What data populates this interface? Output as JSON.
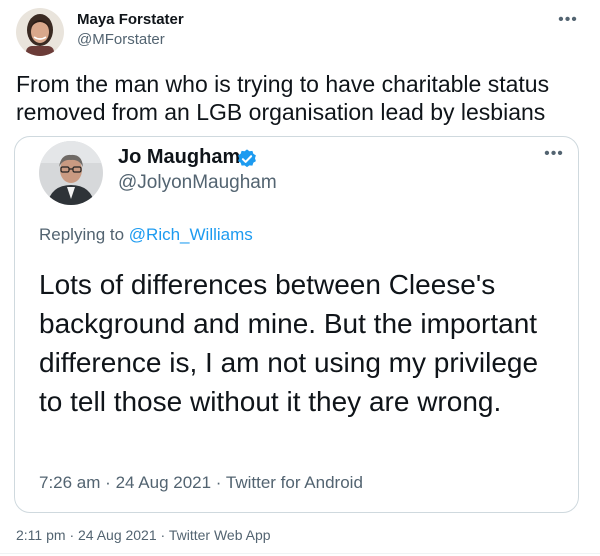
{
  "outer": {
    "name": "Maya Forstater",
    "handle": "@MForstater",
    "text": "From the man who is trying to have charitable status removed from an LGB organisation lead by lesbians",
    "time": "2:11 pm",
    "date": "24 Aug 2021",
    "source": "Twitter Web App",
    "separator": "·"
  },
  "quoted": {
    "name": "Jo Maugham",
    "handle": "@JolyonMaugham",
    "verified": true,
    "replying_prefix": "Replying to ",
    "replying_to": "@Rich_Williams",
    "text": "Lots of differences between Cleese's background and mine. But the important difference is, I am not using my privilege to tell those without it they are wrong.",
    "time": "7:26 am",
    "date": "24 Aug 2021",
    "source": "Twitter for Android",
    "separator": "·"
  },
  "icons": {
    "more": "more-horizontal-icon",
    "verified": "verified-badge-icon"
  },
  "colors": {
    "accent": "#1d9bf0",
    "secondary_text": "#536471",
    "primary_text": "#0f1419",
    "border": "#cfd9de"
  }
}
